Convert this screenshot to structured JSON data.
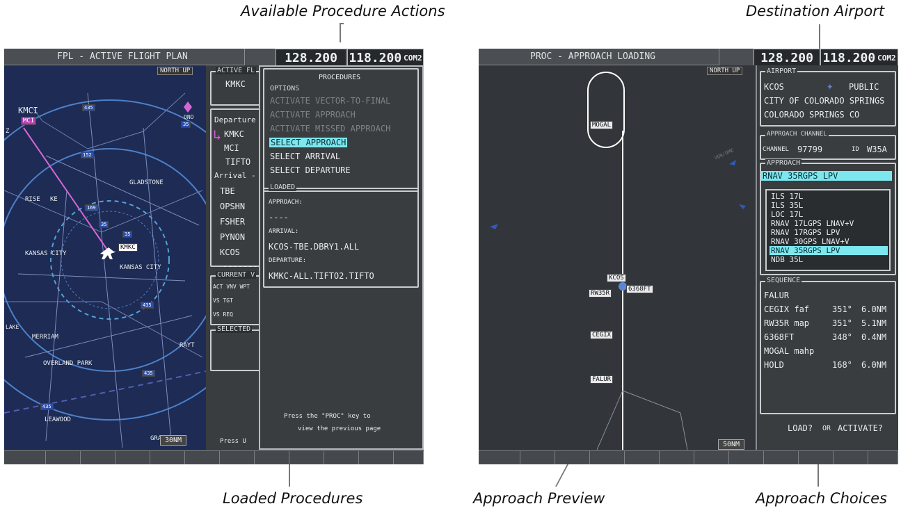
{
  "callouts": {
    "available": "Available Procedure Actions",
    "destination": "Destination Airport",
    "loaded": "Loaded Procedures",
    "preview": "Approach Preview",
    "choices": "Approach Choices"
  },
  "left": {
    "title": "FPL - ACTIVE FLIGHT PLAN",
    "freq1": "128.200",
    "freq2": "118.200",
    "com": "COM2",
    "map": {
      "orient": "NORTH UP",
      "range": "30NM",
      "labels": [
        "KMCI",
        "MCI",
        "RISE",
        "KE",
        "GLADSTONE",
        "KMKC",
        "KANSAS CITY",
        "KANSAS CITY",
        "MERRIAM",
        "OVERLAND PARK",
        "RAYT",
        "LEAWOOD",
        "GRA",
        "LAKE",
        "ONO",
        "Z"
      ],
      "shields": [
        "435",
        "152",
        "169",
        "35",
        "35",
        "35",
        "435",
        "435",
        "435"
      ]
    },
    "fpl": {
      "hdr": "ACTIVE FL",
      "origin": "KMKC",
      "departure": "Departure",
      "dep_wpts": [
        "KMKC",
        "MCI",
        "TIFTO"
      ],
      "arrival": "Arrival -",
      "arr_wpts": [
        "TBE",
        "OPSHN",
        "FSHER",
        "PYNON",
        "KCOS"
      ],
      "dash": "-------",
      "cur": "CURRENT V",
      "act": "ACT VNV WPT",
      "vstgt": "VS TGT",
      "vsreq": "VS REQ",
      "sel": "SELECTED",
      "press": "Press U"
    },
    "proc": {
      "title": "PROCEDURES",
      "options": "OPTIONS",
      "items": [
        "ACTIVATE VECTOR-TO-FINAL",
        "ACTIVATE APPROACH",
        "ACTIVATE MISSED APPROACH",
        "SELECT APPROACH",
        "SELECT ARRIVAL",
        "SELECT DEPARTURE"
      ],
      "loaded": "LOADED",
      "approach_lbl": "APPROACH:",
      "approach_val": "----",
      "arrival_lbl": "ARRIVAL:",
      "arrival_val": "KCOS-TBE.DBRY1.ALL",
      "departure_lbl": "DEPARTURE:",
      "departure_val": "KMKC-ALL.TIFTO2.TIFTO",
      "hint1": "Press the \"PROC\" key to",
      "hint2": "view the previous page"
    }
  },
  "right": {
    "title": "PROC - APPROACH LOADING",
    "freq1": "128.200",
    "freq2": "118.200",
    "com": "COM2",
    "map": {
      "orient": "NORTH UP",
      "range": "50NM",
      "fixes": [
        "MOGAL",
        "KCOS",
        "RW35R",
        "6368FT",
        "CEGIX",
        "FALUR"
      ],
      "faint": "VOR/DME"
    },
    "airport": {
      "hdr": "AIRPORT",
      "id": "KCOS",
      "type": "PUBLIC",
      "city": "CITY OF COLORADO SPRINGS",
      "state": "COLORADO SPRINGS CO"
    },
    "channel": {
      "hdr": "APPROACH CHANNEL",
      "channel_lbl": "CHANNEL",
      "channel": "97799",
      "id_lbl": "ID",
      "id": "W35A"
    },
    "approach": {
      "hdr": "APPROACH",
      "selected": "RNAV 35RGPS LPV",
      "list": [
        "ILS 17L",
        "ILS 35L",
        "LOC 17L",
        "RNAV 17LGPS LNAV+V",
        "RNAV 17RGPS LPV",
        "RNAV 30GPS LNAV+V",
        "RNAV 35RGPS LPV",
        "NDB 35L"
      ]
    },
    "sequence": {
      "hdr": "SEQUENCE",
      "rows": [
        {
          "wpt": "FALUR",
          "crs": "",
          "dist": ""
        },
        {
          "wpt": "CEGIX faf",
          "crs": "351°",
          "dist": "6.0NM"
        },
        {
          "wpt": "RW35R map",
          "crs": "351°",
          "dist": "5.1NM"
        },
        {
          "wpt": "6368FT",
          "crs": "348°",
          "dist": "0.4NM"
        },
        {
          "wpt": "MOGAL mahp",
          "crs": "",
          "dist": ""
        },
        {
          "wpt": "HOLD",
          "crs": "168°",
          "dist": "6.0NM"
        }
      ]
    },
    "load": "LOAD?",
    "or": "OR",
    "activate": "ACTIVATE?"
  }
}
